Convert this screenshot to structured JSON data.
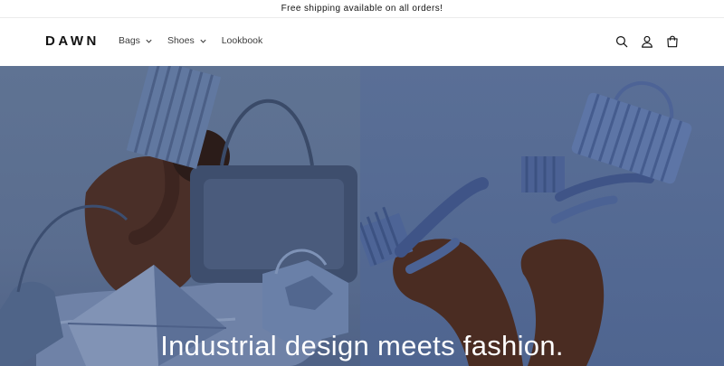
{
  "announcement": {
    "text": "Free shipping available on all orders!"
  },
  "header": {
    "logo": "DAWN",
    "nav": [
      {
        "label": "Bags",
        "has_dropdown": true
      },
      {
        "label": "Shoes",
        "has_dropdown": true
      },
      {
        "label": "Lookbook",
        "has_dropdown": false
      }
    ],
    "icons": [
      "search-icon",
      "account-icon",
      "cart-icon"
    ]
  },
  "hero": {
    "title": "Industrial design meets fashion."
  },
  "colors": {
    "text": "#121212",
    "hero_blue": "#566a8e",
    "hero_text": "#ffffff"
  }
}
